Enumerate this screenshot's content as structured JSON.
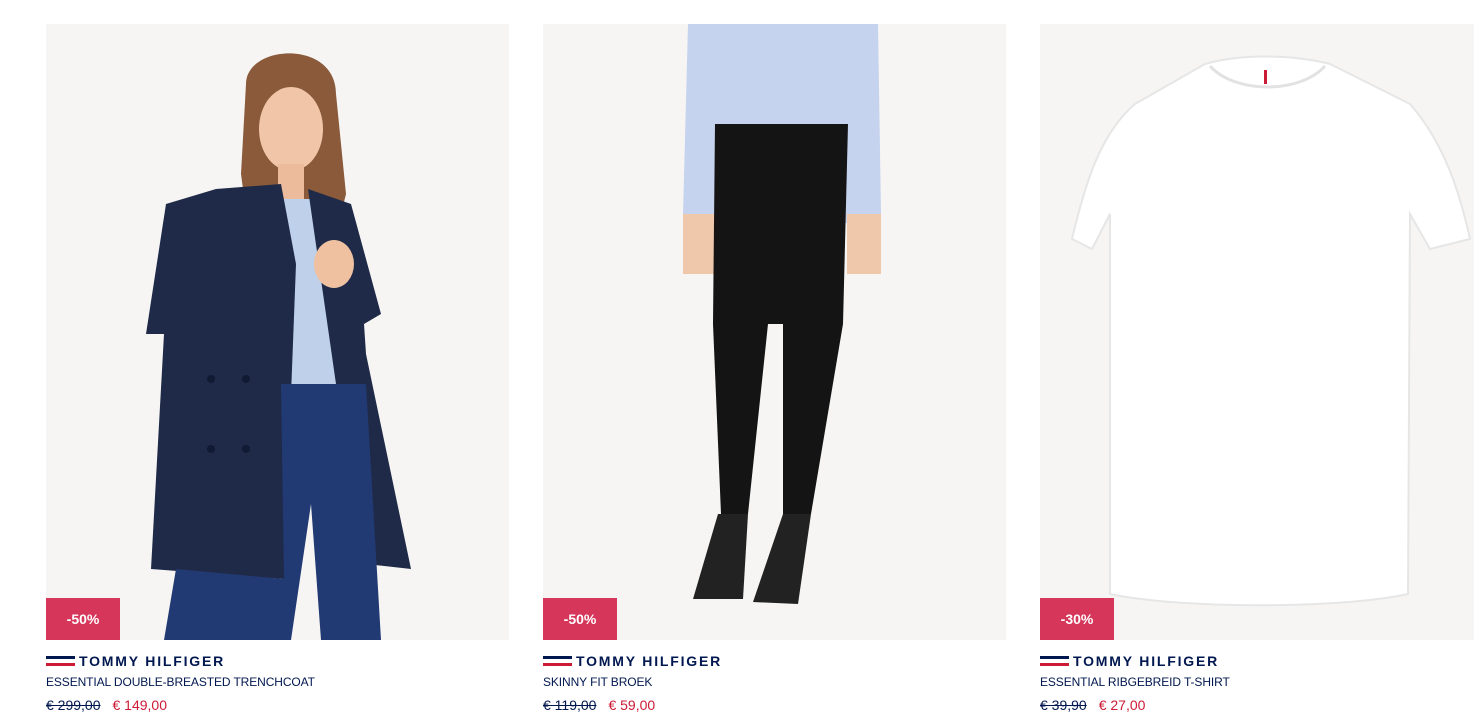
{
  "products": [
    {
      "badge": "-50%",
      "brand": "TOMMY HILFIGER",
      "name": "ESSENTIAL DOUBLE-BREASTED TRENCHCOAT",
      "old_price": "€ 299,00",
      "new_price": "€ 149,00",
      "image_icon": "trenchcoat-photo",
      "swatches": [
        "#00174f",
        "#d6365a"
      ]
    },
    {
      "badge": "-50%",
      "brand": "TOMMY HILFIGER",
      "name": "SKINNY FIT BROEK",
      "old_price": "€ 119,00",
      "new_price": "€ 59,00",
      "image_icon": "skinny-trousers-photo",
      "swatches": [
        "#cfd3da",
        "#cfd3da"
      ]
    },
    {
      "badge": "-30%",
      "brand": "TOMMY HILFIGER",
      "name": "ESSENTIAL RIBGEBREID T-SHIRT",
      "old_price": "€ 39,90",
      "new_price": "€ 27,00",
      "image_icon": "white-tshirt-photo",
      "swatches": [
        "#d6365a",
        "#00174f",
        "#3c7d4c",
        "#9aa3b5"
      ]
    }
  ],
  "colors": {
    "badge_bg": "#d6365a",
    "brand_navy": "#00174f",
    "sale_red": "#cc1b35"
  }
}
